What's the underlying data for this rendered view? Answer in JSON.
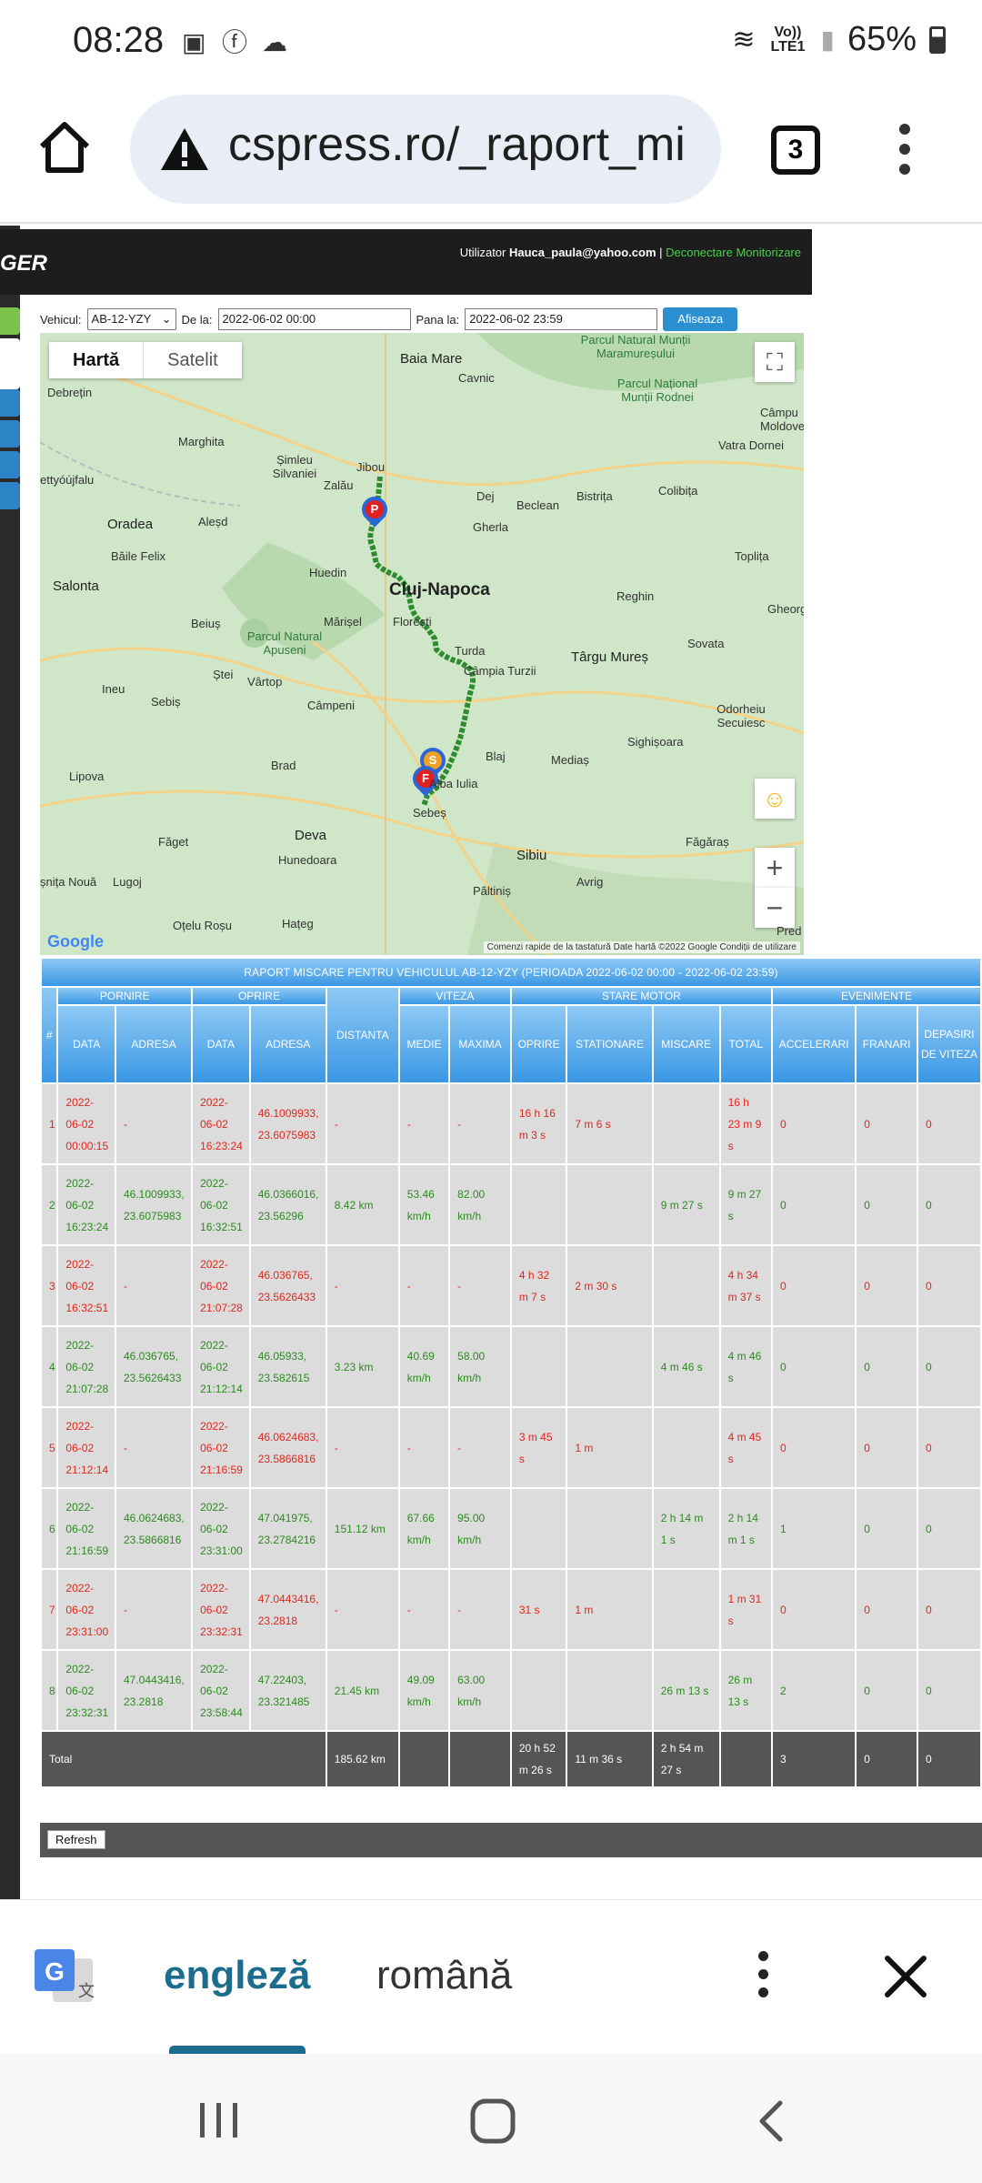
{
  "status_bar": {
    "time": "08:28",
    "network": "Vo)) LTE1",
    "battery": "65%"
  },
  "browser": {
    "url": "cspress.ro/_raport_mi",
    "tab_count": "3"
  },
  "header": {
    "logo": "GER",
    "user_label": "Utilizator",
    "user_email": "Hauca_paula@yahoo.com",
    "separator": " | ",
    "links": "Deconectare Monitorizare"
  },
  "filter": {
    "vehicle_label": "Vehicul:",
    "vehicle_value": "AB-12-YZY",
    "from_label": "De la:",
    "from_value": "2022-06-02 00:00",
    "to_label": "Pana la:",
    "to_value": "2022-06-02 23:59",
    "show_button": "Afiseaza"
  },
  "map": {
    "type_map": "Hartă",
    "type_satellite": "Satelit",
    "zoom_in": "+",
    "zoom_out": "−",
    "attribution": "Comenzi rapide de la tastatură   Date hartă ©2022 Google   Condiții de utilizare",
    "google": "Google",
    "markers": {
      "p": "P",
      "s": "S",
      "f": "F"
    },
    "labels": {
      "baia_mare": "Baia Mare",
      "cavnic": "Cavnic",
      "debretin": "Debrețin",
      "marghita": "Marghita",
      "simleu": "Șimleu Silvaniei",
      "zalau": "Zalău",
      "jibou": "Jibou",
      "dej": "Dej",
      "beclean": "Beclean",
      "bistrita": "Bistrița",
      "colibita": "Colibița",
      "vatra_dornei": "Vatra Dornei",
      "campulung": "Câmpu Moldove",
      "oradea": "Oradea",
      "alesd": "Aleșd",
      "gherla": "Gherla",
      "baile_felix": "Băile Felix",
      "toplita": "Toplița",
      "huedin": "Huedin",
      "cluj": "Cluj-Napoca",
      "reghin": "Reghin",
      "salonta": "Salonta",
      "beius": "Beiuș",
      "marisel": "Mărișel",
      "floresti": "Florești",
      "gheorgheni": "Gheorg",
      "apuseni": "Parcul Natural Apuseni",
      "turda": "Turda",
      "targu_mures": "Târgu Mureș",
      "sovata": "Sovata",
      "stei": "Ștei",
      "vartop": "Vârtop",
      "campia": "Câmpia Turzii",
      "ineu": "Ineu",
      "sebis": "Sebiș",
      "campeni": "Câmpeni",
      "odorheiu": "Odorheiu Secuiesc",
      "sighisoara": "Sighișoara",
      "blaj": "Blaj",
      "medias": "Mediaș",
      "lipova": "Lipova",
      "brad": "Brad",
      "alba": "Alba Iulia",
      "sebes": "Sebeș",
      "deva": "Deva",
      "faget": "Făget",
      "hunedoara": "Hunedoara",
      "sibiu": "Sibiu",
      "fagaras": "Făgăraș",
      "nous": "șnița Nouă",
      "lugoj": "Lugoj",
      "paltinis": "Păltiniș",
      "avrig": "Avrig",
      "otelu": "Oțelu Roșu",
      "hateg": "Hațeg",
      "maramures": "Parcul Natural Munții Maramureșului",
      "rodnei": "Parcul Național Munții Rodnei",
      "ettyoujfalu": "ettyóújfalu",
      "pred": "Pred"
    }
  },
  "report": {
    "title": "RAPORT MISCARE PENTRU VEHICULUL AB-12-YZY (PERIOADA 2022-06-02 00:00 - 2022-06-02 23:59)",
    "groups": {
      "num": "#",
      "start": "PORNIRE",
      "stop": "OPRIRE",
      "distance": "DISTANTA",
      "speed": "VITEZA",
      "engine": "STARE MOTOR",
      "events": "EVENIMENTE"
    },
    "columns": {
      "start_date": "DATA",
      "start_address": "ADRESA",
      "stop_date": "DATA",
      "stop_address": "ADRESA",
      "avg": "MEDIE",
      "max": "MAXIMA",
      "off": "OPRIRE",
      "idle": "STATIONARE",
      "moving": "MISCARE",
      "total": "TOTAL",
      "accel": "ACCELERARI",
      "brake": "FRANARI",
      "overspeed": "DEPASIRI DE VITEZA"
    },
    "rows": [
      {
        "n": "1",
        "sd": "2022-06-02 00:00:15",
        "sa": "-",
        "od": "2022-06-02 16:23:24",
        "oa": "46.1009933, 23.6075983",
        "dist": "-",
        "avg": "-",
        "max": "-",
        "off": "16 h 16 m 3 s",
        "idle": "7 m 6 s",
        "mov": "",
        "tot": "16 h 23 m 9 s",
        "acc": "0",
        "brk": "0",
        "ovs": "0"
      },
      {
        "n": "2",
        "sd": "2022-06-02 16:23:24",
        "sa": "46.1009933, 23.6075983",
        "od": "2022-06-02 16:32:51",
        "oa": "46.0366016, 23.56296",
        "dist": "8.42 km",
        "avg": "53.46 km/h",
        "max": "82.00 km/h",
        "off": "",
        "idle": "",
        "mov": "9 m 27 s",
        "tot": "9 m 27 s",
        "acc": "0",
        "brk": "0",
        "ovs": "0"
      },
      {
        "n": "3",
        "sd": "2022-06-02 16:32:51",
        "sa": "-",
        "od": "2022-06-02 21:07:28",
        "oa": "46.036765, 23.5626433",
        "dist": "-",
        "avg": "-",
        "max": "-",
        "off": "4 h 32 m 7 s",
        "idle": "2 m 30 s",
        "mov": "",
        "tot": "4 h 34 m 37 s",
        "acc": "0",
        "brk": "0",
        "ovs": "0"
      },
      {
        "n": "4",
        "sd": "2022-06-02 21:07:28",
        "sa": "46.036765, 23.5626433",
        "od": "2022-06-02 21:12:14",
        "oa": "46.05933, 23.582615",
        "dist": "3.23 km",
        "avg": "40.69 km/h",
        "max": "58.00 km/h",
        "off": "",
        "idle": "",
        "mov": "4 m 46 s",
        "tot": "4 m 46 s",
        "acc": "0",
        "brk": "0",
        "ovs": "0"
      },
      {
        "n": "5",
        "sd": "2022-06-02 21:12:14",
        "sa": "-",
        "od": "2022-06-02 21:16:59",
        "oa": "46.0624683, 23.5866816",
        "dist": "-",
        "avg": "-",
        "max": "-",
        "off": "3 m 45 s",
        "idle": "1 m",
        "mov": "",
        "tot": "4 m 45 s",
        "acc": "0",
        "brk": "0",
        "ovs": "0"
      },
      {
        "n": "6",
        "sd": "2022-06-02 21:16:59",
        "sa": "46.0624683, 23.5866816",
        "od": "2022-06-02 23:31:00",
        "oa": "47.041975, 23.2784216",
        "dist": "151.12 km",
        "avg": "67.66 km/h",
        "max": "95.00 km/h",
        "off": "",
        "idle": "",
        "mov": "2 h 14 m 1 s",
        "tot": "2 h 14 m 1 s",
        "acc": "1",
        "brk": "0",
        "ovs": "0"
      },
      {
        "n": "7",
        "sd": "2022-06-02 23:31:00",
        "sa": "-",
        "od": "2022-06-02 23:32:31",
        "oa": "47.0443416, 23.2818",
        "dist": "-",
        "avg": "-",
        "max": "-",
        "off": "31 s",
        "idle": "1 m",
        "mov": "",
        "tot": "1 m 31 s",
        "acc": "0",
        "brk": "0",
        "ovs": "0"
      },
      {
        "n": "8",
        "sd": "2022-06-02 23:32:31",
        "sa": "47.0443416, 23.2818",
        "od": "2022-06-02 23:58:44",
        "oa": "47.22403, 23.321485",
        "dist": "21.45 km",
        "avg": "49.09 km/h",
        "max": "63.00 km/h",
        "off": "",
        "idle": "",
        "mov": "26 m 13 s",
        "tot": "26 m 13 s",
        "acc": "2",
        "brk": "0",
        "ovs": "0"
      }
    ],
    "total": {
      "label": "Total",
      "dist": "185.62 km",
      "off": "20 h 52 m 26 s",
      "idle": "11 m 36 s",
      "mov": "2 h 54 m 27 s",
      "acc": "3",
      "brk": "0",
      "ovs": "0"
    },
    "refresh": "Refresh"
  },
  "translate": {
    "lang_en": "engleză",
    "lang_ro": "română"
  },
  "colors": {
    "row_red": "#e0261c",
    "row_green": "#2b8a1e",
    "header_blue": "#3a97e4"
  }
}
